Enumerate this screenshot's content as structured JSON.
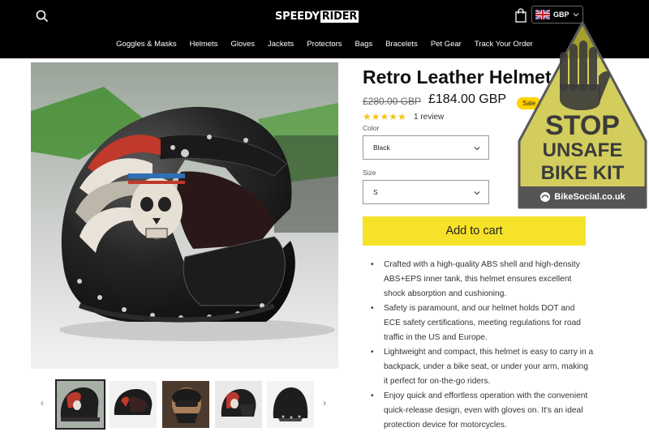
{
  "header": {
    "logo_part1": "SPEEDY",
    "logo_part2": "RIDER",
    "currency": "GBP",
    "nav": [
      "Goggles & Masks",
      "Helmets",
      "Gloves",
      "Jackets",
      "Protectors",
      "Bags",
      "Bracelets",
      "Pet Gear",
      "Track Your Order"
    ]
  },
  "product": {
    "title": "Retro Leather Helmet",
    "old_price": "£280.00 GBP",
    "price": "£184.00 GBP",
    "sale_badge": "Sale",
    "stars": "★★★★★",
    "rating": 5,
    "reviews": "1 review",
    "color_label": "Color",
    "color_value": "Black",
    "size_label": "Size",
    "size_value": "S",
    "add_to_cart": "Add to cart",
    "description": [
      "Crafted with a high-quality ABS shell and high-density ABS+EPS inner tank, this helmet ensures excellent shock absorption and cushioning.",
      "Safety is paramount, and our helmet holds DOT and ECE safety certifications, meeting regulations for road traffic in the US and Europe.",
      "Lightweight and compact, this helmet is easy to carry in a backpack, under a bike seat, or under your arm, making it perfect for on-the-go riders.",
      "Enjoy quick and effortless operation with the convenient quick-release design, even with gloves on. It's an ideal protection device for motorcycles."
    ]
  },
  "gallery": {
    "prev_arrow": "‹",
    "next_arrow": "›",
    "thumb_count": 5
  },
  "overlay": {
    "line1": "STOP",
    "line2": "UNSAFE",
    "line3": "BIKE KIT",
    "brand": "BikeSocial.co.uk",
    "color": "#c9c23a"
  },
  "colors": {
    "header_bg": "#000000",
    "cart_button": "#f7e22a",
    "sale_badge": "#ffd200",
    "stars": "#f5c518"
  }
}
